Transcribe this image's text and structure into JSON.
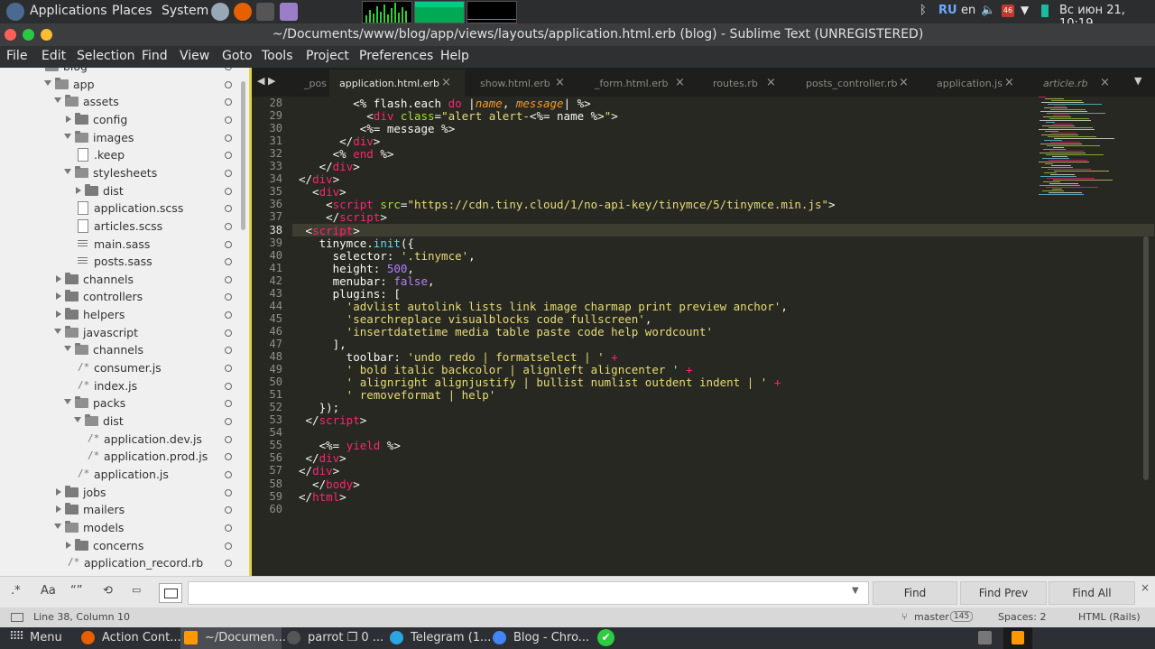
{
  "system_panel": {
    "menus": [
      "Applications",
      "Places",
      "System"
    ],
    "keyboard_layout": "RU",
    "language": "en",
    "datetime": "Вс июн 21, 10:19",
    "notification_count": "46"
  },
  "window": {
    "title": "~/Documents/www/blog/app/views/layouts/application.html.erb (blog) - Sublime Text (UNREGISTERED)"
  },
  "menubar": [
    "File",
    "Edit",
    "Selection",
    "Find",
    "View",
    "Goto",
    "Tools",
    "Project",
    "Preferences",
    "Help"
  ],
  "sidebar": {
    "items": [
      {
        "label": "blog",
        "kind": "folder",
        "state": "open",
        "indent": 0
      },
      {
        "label": "app",
        "kind": "folder",
        "state": "open",
        "indent": 1
      },
      {
        "label": "assets",
        "kind": "folder",
        "state": "open",
        "indent": 2
      },
      {
        "label": "config",
        "kind": "folder",
        "state": "closed",
        "indent": 3
      },
      {
        "label": "images",
        "kind": "folder",
        "state": "open",
        "indent": 3
      },
      {
        "label": ".keep",
        "kind": "file",
        "indent": 4
      },
      {
        "label": "stylesheets",
        "kind": "folder",
        "state": "open",
        "indent": 3
      },
      {
        "label": "dist",
        "kind": "folder",
        "state": "closed",
        "indent": 4
      },
      {
        "label": "application.scss",
        "kind": "file",
        "indent": 4
      },
      {
        "label": "articles.scss",
        "kind": "file",
        "indent": 4
      },
      {
        "label": "main.sass",
        "kind": "lines",
        "indent": 4
      },
      {
        "label": "posts.sass",
        "kind": "lines",
        "indent": 4
      },
      {
        "label": "channels",
        "kind": "folder",
        "state": "closed",
        "indent": 2
      },
      {
        "label": "controllers",
        "kind": "folder",
        "state": "closed",
        "indent": 2
      },
      {
        "label": "helpers",
        "kind": "folder",
        "state": "closed",
        "indent": 2
      },
      {
        "label": "javascript",
        "kind": "folder",
        "state": "open",
        "indent": 2
      },
      {
        "label": "channels",
        "kind": "folder",
        "state": "open",
        "indent": 3
      },
      {
        "label": "consumer.js",
        "kind": "comment",
        "indent": 4
      },
      {
        "label": "index.js",
        "kind": "comment",
        "indent": 4
      },
      {
        "label": "packs",
        "kind": "folder",
        "state": "open",
        "indent": 3
      },
      {
        "label": "dist",
        "kind": "folder",
        "state": "open",
        "indent": 4
      },
      {
        "label": "application.dev.js",
        "kind": "comment",
        "indent": 5
      },
      {
        "label": "application.prod.js",
        "kind": "comment",
        "indent": 5
      },
      {
        "label": "application.js",
        "kind": "comment",
        "indent": 4
      },
      {
        "label": "jobs",
        "kind": "folder",
        "state": "closed",
        "indent": 2
      },
      {
        "label": "mailers",
        "kind": "folder",
        "state": "closed",
        "indent": 2
      },
      {
        "label": "models",
        "kind": "folder",
        "state": "open",
        "indent": 2
      },
      {
        "label": "concerns",
        "kind": "folder",
        "state": "closed",
        "indent": 3
      },
      {
        "label": "application_record.rb",
        "kind": "comment",
        "indent": 3
      }
    ]
  },
  "tabs": [
    {
      "label": "_pos",
      "active": false,
      "italic": false
    },
    {
      "label": "application.html.erb",
      "active": true,
      "italic": false
    },
    {
      "label": "show.html.erb",
      "active": false,
      "italic": false
    },
    {
      "label": "_form.html.erb",
      "active": false,
      "italic": false
    },
    {
      "label": "routes.rb",
      "active": false,
      "italic": false
    },
    {
      "label": "posts_controller.rb",
      "active": false,
      "italic": false
    },
    {
      "label": "application.js",
      "active": false,
      "italic": false
    },
    {
      "label": "article.rb",
      "active": false,
      "italic": true
    }
  ],
  "editor": {
    "current_line": 38,
    "lines": [
      {
        "n": 28,
        "tokens": [
          [
            "w",
            "        <% flash.each "
          ],
          [
            "k",
            "do"
          ],
          [
            "w",
            " |"
          ],
          [
            "i",
            "name"
          ],
          [
            "w",
            ", "
          ],
          [
            "i",
            "message"
          ],
          [
            "w",
            "| %>"
          ]
        ]
      },
      {
        "n": 29,
        "tokens": [
          [
            "w",
            "          <"
          ],
          [
            "k",
            "div"
          ],
          [
            "w",
            " "
          ],
          [
            "g",
            "class"
          ],
          [
            "w",
            "="
          ],
          [
            "s",
            "\"alert alert-"
          ],
          [
            "w",
            "<%= name %>"
          ],
          [
            "s",
            "\""
          ],
          [
            "w",
            ">"
          ]
        ]
      },
      {
        "n": 30,
        "tokens": [
          [
            "w",
            "         <%= message %>"
          ]
        ]
      },
      {
        "n": 31,
        "tokens": [
          [
            "w",
            "      </"
          ],
          [
            "k",
            "div"
          ],
          [
            "w",
            ">"
          ]
        ]
      },
      {
        "n": 32,
        "tokens": [
          [
            "w",
            "     <% "
          ],
          [
            "k",
            "end"
          ],
          [
            "w",
            " %>"
          ]
        ]
      },
      {
        "n": 33,
        "tokens": [
          [
            "w",
            "   </"
          ],
          [
            "k",
            "div"
          ],
          [
            "w",
            ">"
          ]
        ]
      },
      {
        "n": 34,
        "tokens": [
          [
            "w",
            "</"
          ],
          [
            "k",
            "div"
          ],
          [
            "w",
            ">"
          ]
        ]
      },
      {
        "n": 35,
        "tokens": [
          [
            "w",
            "  <"
          ],
          [
            "k",
            "div"
          ],
          [
            "w",
            ">"
          ]
        ]
      },
      {
        "n": 36,
        "tokens": [
          [
            "w",
            "    <"
          ],
          [
            "k",
            "script"
          ],
          [
            "w",
            " "
          ],
          [
            "g",
            "src"
          ],
          [
            "w",
            "="
          ],
          [
            "s",
            "\"https://cdn.tiny.cloud/1/no-api-key/tinymce/5/tinymce.min.js\""
          ],
          [
            "w",
            ">"
          ]
        ]
      },
      {
        "n": 37,
        "tokens": [
          [
            "w",
            "    </"
          ],
          [
            "k",
            "script"
          ],
          [
            "w",
            ">"
          ]
        ]
      },
      {
        "n": 38,
        "tokens": [
          [
            "w",
            " <"
          ],
          [
            "k",
            "script"
          ],
          [
            "w",
            ">"
          ]
        ]
      },
      {
        "n": 39,
        "tokens": [
          [
            "w",
            "   tinymce."
          ],
          [
            "f",
            "init"
          ],
          [
            "w",
            "({"
          ]
        ]
      },
      {
        "n": 40,
        "tokens": [
          [
            "w",
            "     selector: "
          ],
          [
            "s",
            "'.tinymce'"
          ],
          [
            "w",
            ","
          ]
        ]
      },
      {
        "n": 41,
        "tokens": [
          [
            "w",
            "     height: "
          ],
          [
            "n",
            "500"
          ],
          [
            "w",
            ","
          ]
        ]
      },
      {
        "n": 42,
        "tokens": [
          [
            "w",
            "     menubar: "
          ],
          [
            "n",
            "false"
          ],
          [
            "w",
            ","
          ]
        ]
      },
      {
        "n": 43,
        "tokens": [
          [
            "w",
            "     plugins: ["
          ]
        ]
      },
      {
        "n": 44,
        "tokens": [
          [
            "s",
            "       'advlist autolink lists link image charmap print preview anchor'"
          ],
          [
            "w",
            ","
          ]
        ]
      },
      {
        "n": 45,
        "tokens": [
          [
            "s",
            "       'searchreplace visualblocks code fullscreen'"
          ],
          [
            "w",
            ","
          ]
        ]
      },
      {
        "n": 46,
        "tokens": [
          [
            "s",
            "       'insertdatetime media table paste code help wordcount'"
          ]
        ]
      },
      {
        "n": 47,
        "tokens": [
          [
            "w",
            "     ],"
          ]
        ]
      },
      {
        "n": 48,
        "tokens": [
          [
            "w",
            "       toolbar: "
          ],
          [
            "s",
            "'undo redo | formatselect | '"
          ],
          [
            "w",
            " "
          ],
          [
            "k",
            "+"
          ]
        ]
      },
      {
        "n": 49,
        "tokens": [
          [
            "s",
            "       ' bold italic backcolor | alignleft aligncenter '"
          ],
          [
            "w",
            " "
          ],
          [
            "k",
            "+"
          ]
        ]
      },
      {
        "n": 50,
        "tokens": [
          [
            "s",
            "       ' alignright alignjustify | bullist numlist outdent indent | '"
          ],
          [
            "w",
            " "
          ],
          [
            "k",
            "+"
          ]
        ]
      },
      {
        "n": 51,
        "tokens": [
          [
            "s",
            "       ' removeformat | help'"
          ]
        ]
      },
      {
        "n": 52,
        "tokens": [
          [
            "w",
            "   });"
          ]
        ]
      },
      {
        "n": 53,
        "tokens": [
          [
            "w",
            " </"
          ],
          [
            "k",
            "script"
          ],
          [
            "w",
            ">"
          ]
        ]
      },
      {
        "n": 54,
        "tokens": []
      },
      {
        "n": 55,
        "tokens": [
          [
            "w",
            "   <%= "
          ],
          [
            "k",
            "yield"
          ],
          [
            "w",
            " %>"
          ]
        ]
      },
      {
        "n": 56,
        "tokens": [
          [
            "w",
            " </"
          ],
          [
            "k",
            "div"
          ],
          [
            "w",
            ">"
          ]
        ]
      },
      {
        "n": 57,
        "tokens": [
          [
            "w",
            "</"
          ],
          [
            "k",
            "div"
          ],
          [
            "w",
            ">"
          ]
        ]
      },
      {
        "n": 58,
        "tokens": [
          [
            "w",
            "  </"
          ],
          [
            "k",
            "body"
          ],
          [
            "w",
            ">"
          ]
        ]
      },
      {
        "n": 59,
        "tokens": [
          [
            "w",
            "</"
          ],
          [
            "k",
            "html"
          ],
          [
            "w",
            ">"
          ]
        ]
      },
      {
        "n": 60,
        "tokens": []
      }
    ]
  },
  "find_panel": {
    "regex_icon": ".*",
    "case_icon": "Aa",
    "word_icon": "“”",
    "find_label": "Find",
    "find_prev_label": "Find Prev",
    "find_all_label": "Find All",
    "query": ""
  },
  "status": {
    "position": "Line 38, Column 10",
    "branch": "master",
    "changes": "145",
    "indent": "Spaces: 2",
    "syntax": "HTML (Rails)"
  },
  "taskbar": {
    "menu_label": "Menu",
    "tasks": [
      {
        "label": "Action Cont...",
        "icon": "firefox-icon",
        "color": "#e66000"
      },
      {
        "label": "~/Documen...",
        "icon": "sublime-icon",
        "color": "#ff9800",
        "active": true
      },
      {
        "label": "parrot ❐ 0 ...",
        "icon": "terminal-icon",
        "color": "#555555"
      },
      {
        "label": "Telegram (1...",
        "icon": "telegram-icon",
        "color": "#2ca5e0"
      },
      {
        "label": "Blog - Chro...",
        "icon": "chrome-icon",
        "color": "#4285f4"
      }
    ]
  },
  "colors": {
    "editor_bg": "#272822",
    "keyword": "#f92672",
    "string": "#e6db74",
    "number": "#ae81ff",
    "function": "#66d9ef",
    "attribute": "#a6e22e",
    "param": "#fd971f"
  }
}
